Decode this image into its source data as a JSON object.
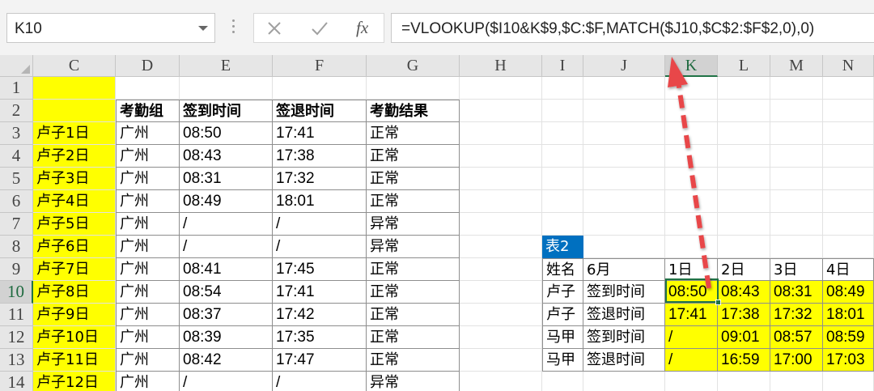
{
  "formula_bar": {
    "name_box": "K10",
    "cancel_icon": "close-icon",
    "enter_icon": "check-icon",
    "function_label": "fx",
    "formula": "=VLOOKUP($I10&K$9,$C:$F,MATCH($J10,$C$2:$F$2,0),0)"
  },
  "columns": [
    "C",
    "D",
    "E",
    "F",
    "G",
    "H",
    "I",
    "J",
    "K",
    "L",
    "M",
    "N"
  ],
  "rows": [
    "1",
    "2",
    "3",
    "4",
    "5",
    "6",
    "7",
    "8",
    "9",
    "10",
    "11",
    "12",
    "13",
    "14"
  ],
  "selected_cell": "K10",
  "left_table": {
    "headers": [
      "",
      "考勤组",
      "签到时间",
      "签退时间",
      "考勤结果"
    ],
    "rows": [
      [
        "卢子1日",
        "广州",
        "08:50",
        "17:41",
        "正常"
      ],
      [
        "卢子2日",
        "广州",
        "08:43",
        "17:38",
        "正常"
      ],
      [
        "卢子3日",
        "广州",
        "08:31",
        "17:32",
        "正常"
      ],
      [
        "卢子4日",
        "广州",
        "08:49",
        "18:01",
        "正常"
      ],
      [
        "卢子5日",
        "广州",
        "/",
        "/",
        "异常"
      ],
      [
        "卢子6日",
        "广州",
        "/",
        "/",
        "异常"
      ],
      [
        "卢子7日",
        "广州",
        "08:41",
        "17:45",
        "正常"
      ],
      [
        "卢子8日",
        "广州",
        "08:54",
        "17:41",
        "正常"
      ],
      [
        "卢子9日",
        "广州",
        "08:37",
        "17:42",
        "正常"
      ],
      [
        "卢子10日",
        "广州",
        "08:39",
        "17:35",
        "正常"
      ],
      [
        "卢子11日",
        "广州",
        "08:42",
        "17:47",
        "正常"
      ],
      [
        "卢子12日",
        "广州",
        "/",
        "/",
        "异常"
      ]
    ]
  },
  "right_table": {
    "title": "表2",
    "headers": [
      "姓名",
      "6月",
      "1日",
      "2日",
      "3日",
      "4日"
    ],
    "rows": [
      [
        "卢子",
        "签到时间",
        "08:50",
        "08:43",
        "08:31",
        "08:49"
      ],
      [
        "卢子",
        "签退时间",
        "17:41",
        "17:38",
        "17:32",
        "18:01"
      ],
      [
        "马甲",
        "签到时间",
        "/",
        "09:01",
        "08:57",
        "08:59"
      ],
      [
        "马甲",
        "签退时间",
        "/",
        "16:59",
        "17:00",
        "17:03"
      ]
    ]
  },
  "colors": {
    "highlight": "#ffff00",
    "selection": "#217346",
    "title_tag": "#0070c0",
    "arrow": "#e8464a"
  }
}
